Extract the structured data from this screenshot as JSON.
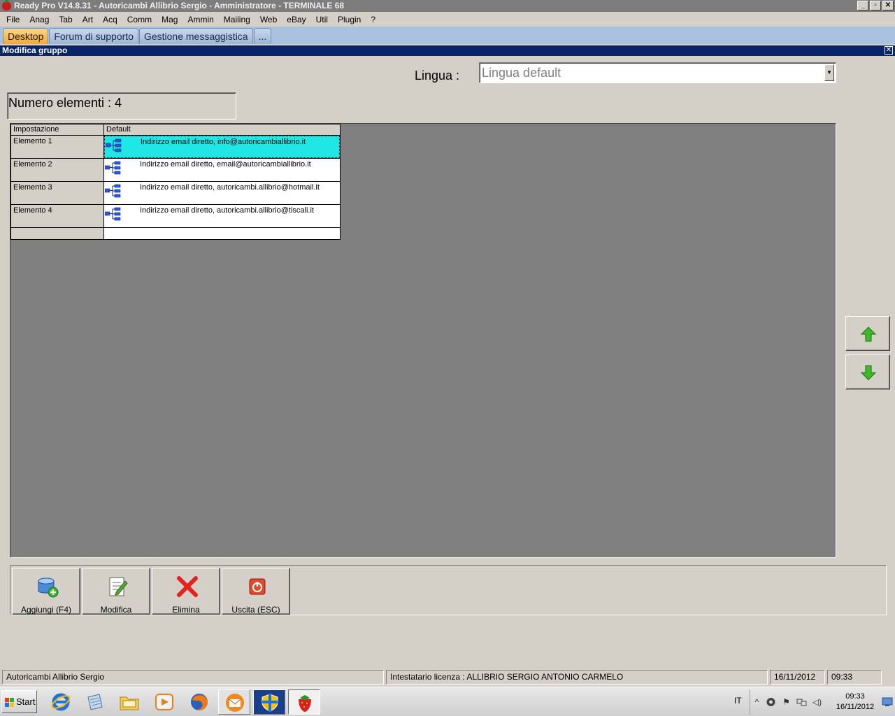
{
  "window": {
    "title": "Ready Pro V14.8.31 - Autoricambi Allibrio Sergio - Amministratore - TERMINALE 68",
    "buttons": [
      "_",
      "▫",
      "✕"
    ]
  },
  "menu": [
    "File",
    "Anag",
    "Tab",
    "Art",
    "Acq",
    "Comm",
    "Mag",
    "Ammin",
    "Mailing",
    "Web",
    "eBay",
    "Util",
    "Plugin",
    "?"
  ],
  "tabs": [
    {
      "label": "Desktop",
      "active": true
    },
    {
      "label": "Forum di supporto",
      "active": false
    },
    {
      "label": "Gestione messaggistica",
      "active": false
    },
    {
      "label": "...",
      "active": false
    }
  ],
  "subwindow": {
    "title": "Modifica gruppo",
    "close": "✕"
  },
  "lingua": {
    "label": "Lingua :",
    "value": "Lingua default",
    "dropdown_glyph": "▼"
  },
  "numero": {
    "text": "Numero elementi : 4"
  },
  "grid": {
    "headers": [
      "Impostazione",
      "Default"
    ],
    "rows": [
      {
        "name": "Elemento 1",
        "value": "Indirizzo email diretto, info@autoricambiallibrio.it",
        "selected": true
      },
      {
        "name": "Elemento 2",
        "value": "Indirizzo email diretto, email@autoricambiallibrio.it",
        "selected": false
      },
      {
        "name": "Elemento 3",
        "value": "Indirizzo email diretto, autoricambi.allibrio@hotmail.it",
        "selected": false
      },
      {
        "name": "Elemento 4",
        "value": "Indirizzo email diretto, autoricambi.allibrio@tiscali.it",
        "selected": false
      }
    ]
  },
  "arrows": {
    "up_icon": "arrow-up-icon",
    "down_icon": "arrow-down-icon"
  },
  "toolbar": {
    "add_label": "Aggiungi (F4)",
    "edit_label": "Modifica",
    "delete_label": "Elimina",
    "exit_label": "Uscita (ESC)"
  },
  "status": {
    "company": "Autoricambi Allibrio Sergio",
    "license": "Intestatario licenza : ALLIBRIO SERGIO ANTONIO CARMELO",
    "date": "16/11/2012",
    "time": "09:33"
  },
  "taskbar": {
    "start_label": "Start",
    "language": "IT",
    "clock_time": "09:33",
    "clock_date": "16/11/2012",
    "tray_chevron": "^",
    "tray_flag": "⚑",
    "tray_volume": "◁)"
  },
  "colors": {
    "selected_row": "#20e6e6",
    "subwindow_header": "#0a246a",
    "active_tab": "#f5a934",
    "arrow_green": "#3bbb2a",
    "delete_red": "#e0261c"
  }
}
